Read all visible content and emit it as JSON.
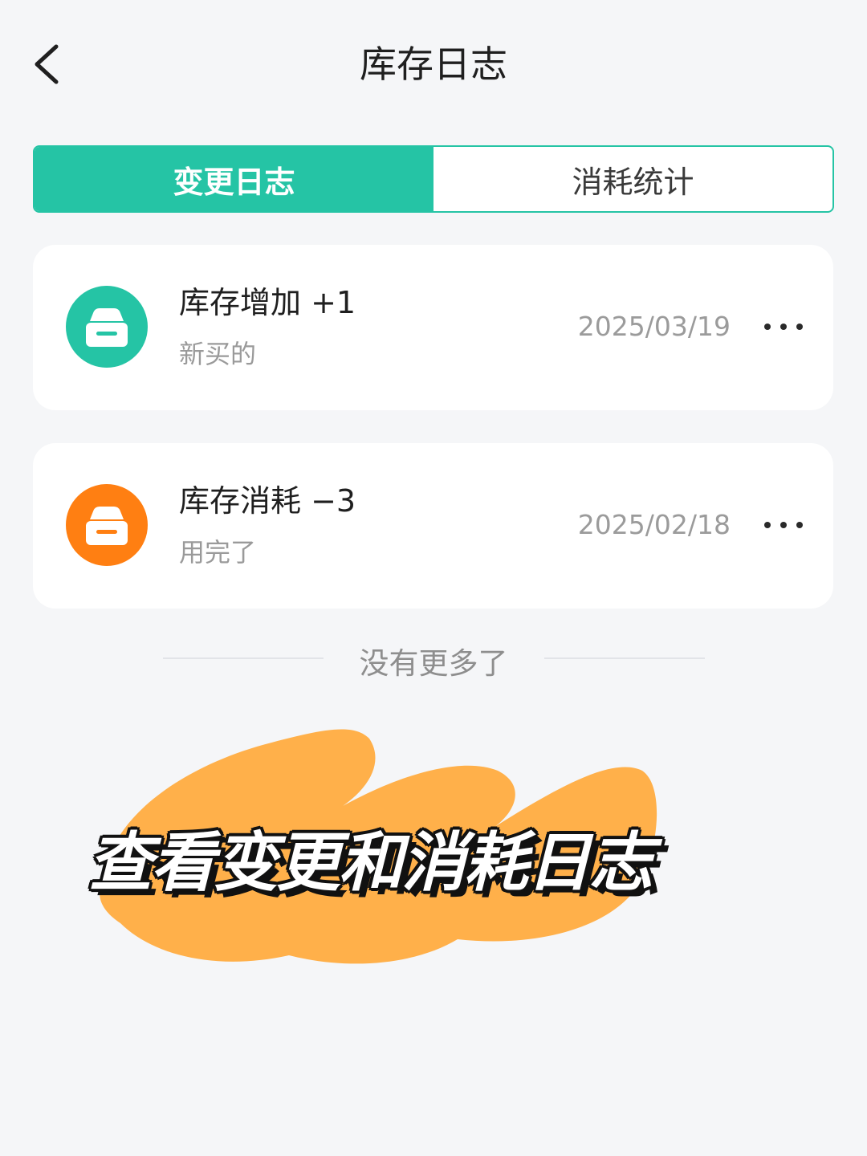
{
  "header": {
    "title": "库存日志",
    "back_icon": "chevron-left-icon"
  },
  "tabs": [
    {
      "label": "变更日志",
      "active": true
    },
    {
      "label": "消耗统计",
      "active": false
    }
  ],
  "logs": [
    {
      "title": "库存增加 +1",
      "note": "新买的",
      "date": "2025/03/19",
      "icon": "box-icon",
      "icon_color": "#25c4a5"
    },
    {
      "title": "库存消耗 −3",
      "note": "用完了",
      "date": "2025/02/18",
      "icon": "box-icon",
      "icon_color": "#ff7f12"
    }
  ],
  "list_end_text": "没有更多了",
  "overlay_caption": "查看变更和消耗日志",
  "colors": {
    "accent": "#25c4a5",
    "orange": "#ff7f12",
    "highlight": "#ffb04a",
    "background": "#f5f6f8"
  }
}
